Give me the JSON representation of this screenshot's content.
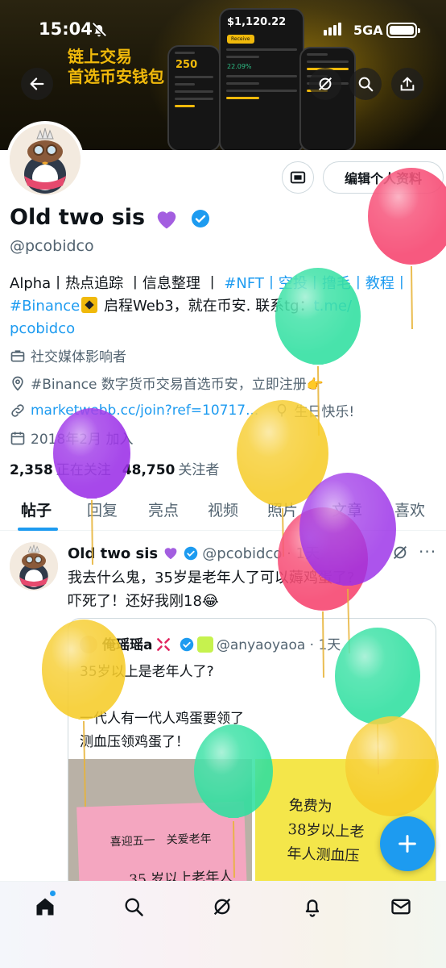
{
  "status_bar": {
    "time": "15:04",
    "network": "5GA"
  },
  "banner": {
    "slogan_line1": "链上交易",
    "slogan_line2": "首选币安钱包",
    "phone_balance": "$1,120.22",
    "phone_points": "250",
    "phone_change": "22.09%",
    "phone_tab": "Receive"
  },
  "profile": {
    "display_name": "Old two sis",
    "handle": "@pcobidco",
    "edit_button": "编辑个人资料",
    "bio": {
      "part1": "Alpha丨热点追踪 丨信息整理 丨 ",
      "tags1": "#NFT",
      "part2": "丨空投丨撸毛丨教程丨",
      "tag_binance": "#Binance",
      "part3": " 启程Web3，就在币安. 联系tg：",
      "link_tg_1": "t.me/",
      "link_tg_2": "pcobidco"
    },
    "category": "社交媒体影响者",
    "location": "#Binance 数字货币交易首选币安，立即注册👉",
    "website": "marketwebb.cc/join?ref=10717...",
    "birthday": "生日快乐!",
    "joined": "2018年2月 加入",
    "following_count": "2,358",
    "following_label": "正在关注",
    "followers_count": "48,750",
    "followers_label": "关注者"
  },
  "tabs": [
    "帖子",
    "回复",
    "亮点",
    "视频",
    "照片",
    "文章",
    "喜欢"
  ],
  "tweet": {
    "name": "Old two sis",
    "handle_time": "@pcobidco · 1天",
    "text_line1": "我去什么鬼，35岁是老年人了可以薅鸡蛋了?",
    "text_line2": "吓死了！还好我刚18😂",
    "quote": {
      "name": "俺瑶瑶a",
      "handle_time": "@anyaoyaoa · 1天",
      "text": "35岁以上是老年人了?\n\n一代人有一代人鸡蛋要领了\n测血压领鸡蛋了！",
      "image_left_line1": "喜迎五一　关爱老年",
      "image_left_line2": "35 岁以上老年人",
      "image_right_text": "免费为\n38岁以上老\n年人测血压"
    }
  },
  "colors": {
    "accent": "#1d9bf0",
    "binance_gold": "#f0b90b",
    "text_primary": "#0f1419",
    "text_secondary": "#536471",
    "verified": "#1d9bf0"
  },
  "icons": [
    "back-arrow-icon",
    "grok-icon",
    "search-icon",
    "share-icon",
    "message-icon",
    "verified-badge-icon",
    "briefcase-icon",
    "location-pin-icon",
    "link-icon",
    "balloon-icon",
    "calendar-icon",
    "more-icon",
    "plus-icon",
    "home-icon",
    "notifications-bell-icon",
    "mail-icon"
  ]
}
